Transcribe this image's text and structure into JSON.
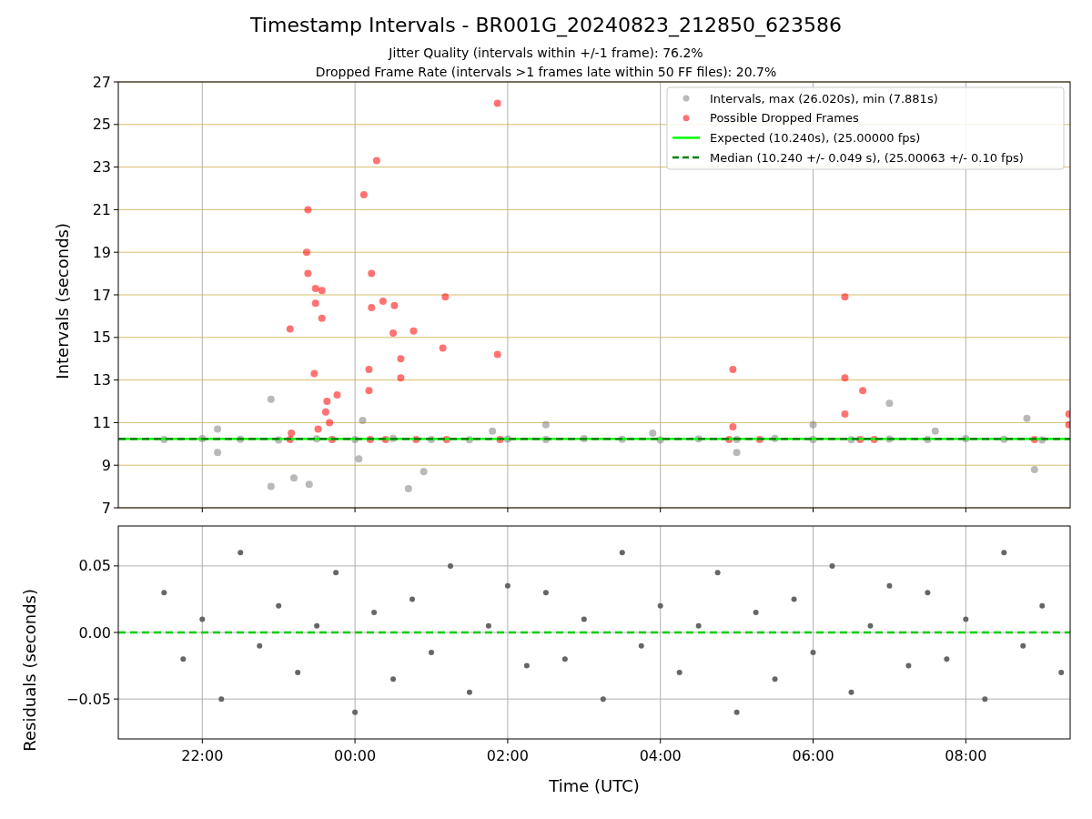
{
  "figure": {
    "title": "Timestamp Intervals - BR001G_20240823_212850_623586",
    "subtitles": [
      "Jitter Quality (intervals within +/-1 frame): 76.2%",
      "Dropped Frame Rate (intervals >1 frames late within 50 FF files): 20.7%"
    ]
  },
  "intervals_plot": {
    "chart_data": {
      "type": "scatter",
      "ylabel": "Intervals (seconds)",
      "grid": true,
      "xlim": [
        "2024-08-23T20:54",
        "2024-08-24T09:22"
      ],
      "ylim": [
        7,
        27
      ],
      "yticks": [
        7,
        9,
        11,
        13,
        15,
        17,
        19,
        21,
        23,
        25,
        27
      ],
      "series": [
        {
          "name": "Intervals, max (26.020s), min (7.881s)",
          "color": "#808080",
          "x": [
            "2024-08-23T21:30",
            "2024-08-23T22:00",
            "2024-08-23T22:30",
            "2024-08-23T23:00",
            "2024-08-23T23:30",
            "2024-08-24T00:00",
            "2024-08-24T00:30",
            "2024-08-24T01:00",
            "2024-08-24T01:30",
            "2024-08-24T02:00",
            "2024-08-24T02:30",
            "2024-08-24T03:00",
            "2024-08-24T03:30",
            "2024-08-24T04:00",
            "2024-08-24T04:30",
            "2024-08-24T05:00",
            "2024-08-24T05:30",
            "2024-08-24T06:00",
            "2024-08-24T06:30",
            "2024-08-24T07:00",
            "2024-08-24T07:30",
            "2024-08-24T08:00",
            "2024-08-24T08:30",
            "2024-08-24T09:00",
            "2024-08-23T22:54",
            "2024-08-23T22:54",
            "2024-08-23T23:12",
            "2024-08-23T23:24",
            "2024-08-24T00:42",
            "2024-08-24T00:54",
            "2024-08-23T22:12",
            "2024-08-23T22:12",
            "2024-08-24T01:48",
            "2024-08-24T02:30",
            "2024-08-24T07:00",
            "2024-08-24T06:00",
            "2024-08-24T08:48",
            "2024-08-24T08:54",
            "2024-08-24T05:00",
            "2024-08-24T00:06",
            "2024-08-24T00:03",
            "2024-08-24T03:54",
            "2024-08-24T07:36"
          ],
          "values": [
            10.2,
            10.25,
            10.22,
            10.18,
            10.24,
            10.2,
            10.26,
            10.21,
            10.19,
            10.23,
            10.2,
            10.25,
            10.22,
            10.18,
            10.24,
            10.2,
            10.26,
            10.21,
            10.19,
            10.23,
            10.2,
            10.25,
            10.22,
            10.18,
            12.1,
            8.0,
            8.4,
            8.1,
            7.9,
            8.7,
            10.7,
            9.6,
            10.6,
            10.9,
            11.9,
            10.9,
            11.2,
            8.8,
            9.6,
            11.1,
            9.3,
            10.5,
            10.6
          ]
        },
        {
          "name": "Possible Dropped Frames",
          "color": "#ff0000",
          "x": [
            "2024-08-24T01:52",
            "2024-08-24T00:17",
            "2024-08-24T00:07",
            "2024-08-23T23:23",
            "2024-08-23T23:22",
            "2024-08-24T00:13",
            "2024-08-23T23:23",
            "2024-08-23T23:29",
            "2024-08-23T23:34",
            "2024-08-23T23:29",
            "2024-08-24T01:11",
            "2024-08-24T00:22",
            "2024-08-24T00:31",
            "2024-08-24T00:13",
            "2024-08-23T23:34",
            "2024-08-23T23:09",
            "2024-08-24T00:46",
            "2024-08-24T00:30",
            "2024-08-24T01:09",
            "2024-08-24T01:52",
            "2024-08-24T00:36",
            "2024-08-24T00:11",
            "2024-08-23T23:28",
            "2024-08-24T00:36",
            "2024-08-24T00:11",
            "2024-08-23T23:46",
            "2024-08-23T23:38",
            "2024-08-23T23:37",
            "2024-08-23T23:40",
            "2024-08-23T23:31",
            "2024-08-23T23:10",
            "2024-08-24T04:57",
            "2024-08-24T04:57",
            "2024-08-24T06:25",
            "2024-08-24T06:25",
            "2024-08-24T06:39",
            "2024-08-24T06:25",
            "2024-08-23T23:09",
            "2024-08-23T23:42",
            "2024-08-24T00:12",
            "2024-08-24T00:24",
            "2024-08-24T00:48",
            "2024-08-24T01:12",
            "2024-08-24T01:54",
            "2024-08-24T04:54",
            "2024-08-24T05:18",
            "2024-08-24T06:37",
            "2024-08-24T06:48",
            "2024-08-24T08:54",
            "2024-08-24T09:21",
            "2024-08-24T09:21"
          ],
          "values": [
            26.0,
            23.3,
            21.7,
            21.0,
            19.0,
            18.0,
            18.0,
            17.3,
            17.2,
            16.6,
            16.9,
            16.7,
            16.5,
            16.4,
            15.9,
            15.4,
            15.3,
            15.2,
            14.5,
            14.2,
            14.0,
            13.5,
            13.3,
            13.1,
            12.5,
            12.3,
            12.0,
            11.5,
            11.0,
            10.7,
            10.5,
            13.5,
            10.8,
            16.9,
            13.1,
            12.5,
            11.4,
            10.2,
            10.2,
            10.2,
            10.2,
            10.2,
            10.2,
            10.2,
            10.2,
            10.2,
            10.2,
            10.2,
            10.2,
            11.4,
            10.9
          ]
        }
      ],
      "legend": true,
      "ref_lines": [
        {
          "axis": "y",
          "value": 10.24,
          "label": "Expected (10.240s), (25.00000 fps)",
          "color": "#00ff00"
        },
        {
          "axis": "y",
          "value": 10.24,
          "label": "Median (10.240 +/- 0.049 s), (25.00063 +/- 0.10 fps)",
          "color": "#008000"
        }
      ]
    }
  },
  "residuals_plot": {
    "chart_data": {
      "type": "scatter",
      "xlabel": "Time (UTC)",
      "ylabel": "Residuals (seconds)",
      "grid": true,
      "xlim": [
        "2024-08-23T20:54",
        "2024-08-24T09:22"
      ],
      "ylim": [
        -0.08,
        0.08
      ],
      "yticks": [
        {
          "value": -0.05,
          "label": "−0.05"
        },
        {
          "value": 0,
          "label": "0.00"
        },
        {
          "value": 0.05,
          "label": "0.05"
        }
      ],
      "xticks": [
        {
          "value": "2024-08-23T22:00",
          "label": "22:00"
        },
        {
          "value": "2024-08-24T00:00",
          "label": "00:00"
        },
        {
          "value": "2024-08-24T02:00",
          "label": "02:00"
        },
        {
          "value": "2024-08-24T04:00",
          "label": "04:00"
        },
        {
          "value": "2024-08-24T06:00",
          "label": "06:00"
        },
        {
          "value": "2024-08-24T08:00",
          "label": "08:00"
        }
      ],
      "series": [
        {
          "color": "#666666",
          "x": [
            "2024-08-23T21:30",
            "2024-08-23T21:45",
            "2024-08-23T22:00",
            "2024-08-23T22:15",
            "2024-08-23T22:30",
            "2024-08-23T22:45",
            "2024-08-23T23:00",
            "2024-08-23T23:15",
            "2024-08-23T23:30",
            "2024-08-23T23:45",
            "2024-08-24T00:00",
            "2024-08-24T00:15",
            "2024-08-24T00:30",
            "2024-08-24T00:45",
            "2024-08-24T01:00",
            "2024-08-24T01:15",
            "2024-08-24T01:30",
            "2024-08-24T01:45",
            "2024-08-24T02:00",
            "2024-08-24T02:15",
            "2024-08-24T02:30",
            "2024-08-24T02:45",
            "2024-08-24T03:00",
            "2024-08-24T03:15",
            "2024-08-24T03:30",
            "2024-08-24T03:45",
            "2024-08-24T04:00",
            "2024-08-24T04:15",
            "2024-08-24T04:30",
            "2024-08-24T04:45",
            "2024-08-24T05:00",
            "2024-08-24T05:15",
            "2024-08-24T05:30",
            "2024-08-24T05:45",
            "2024-08-24T06:00",
            "2024-08-24T06:15",
            "2024-08-24T06:30",
            "2024-08-24T06:45",
            "2024-08-24T07:00",
            "2024-08-24T07:15",
            "2024-08-24T07:30",
            "2024-08-24T07:45",
            "2024-08-24T08:00",
            "2024-08-24T08:15",
            "2024-08-24T08:30",
            "2024-08-24T08:45",
            "2024-08-24T09:00",
            "2024-08-24T09:15"
          ],
          "values": [
            0.03,
            -0.02,
            0.01,
            -0.05,
            0.06,
            -0.01,
            0.02,
            -0.03,
            0.005,
            0.045,
            -0.06,
            0.015,
            -0.035,
            0.025,
            -0.015,
            0.05,
            -0.045,
            0.005,
            0.035,
            -0.025,
            0.03,
            -0.02,
            0.01,
            -0.05,
            0.06,
            -0.01,
            0.02,
            -0.03,
            0.005,
            0.045,
            -0.06,
            0.015,
            -0.035,
            0.025,
            -0.015,
            0.05,
            -0.045,
            0.005,
            0.035,
            -0.025,
            0.03,
            -0.02,
            0.01,
            -0.05,
            0.06,
            -0.01,
            0.02,
            -0.03
          ]
        }
      ],
      "ref_lines": [
        {
          "axis": "y",
          "value": 0,
          "color": "#00cc00"
        }
      ]
    }
  }
}
